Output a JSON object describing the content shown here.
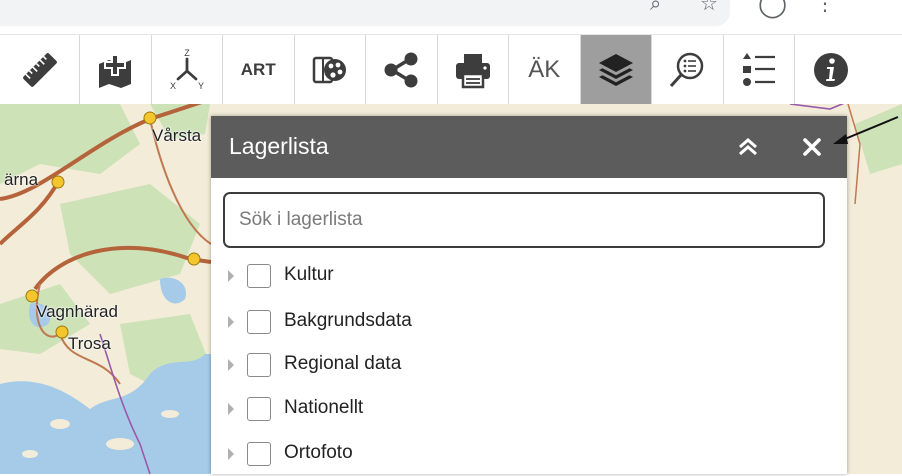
{
  "toolbar": {
    "items": [
      {
        "name": "ruler-icon"
      },
      {
        "name": "add-map-icon"
      },
      {
        "name": "xyz-coordinates-icon",
        "glyphs": [
          "Z",
          "X",
          "Y"
        ]
      },
      {
        "name": "art-tool",
        "text": "ART"
      },
      {
        "name": "palette-icon"
      },
      {
        "name": "share-icon"
      },
      {
        "name": "print-icon"
      },
      {
        "name": "ak-tool",
        "text": "ÄK"
      },
      {
        "name": "layers-icon",
        "active": true
      },
      {
        "name": "search-map-icon"
      },
      {
        "name": "legend-list-icon"
      },
      {
        "name": "info-icon"
      }
    ]
  },
  "map": {
    "labels": [
      "Vårsta",
      "ärna",
      "Vagnhärad",
      "Trosa"
    ]
  },
  "panel": {
    "title": "Lagerlista",
    "search_placeholder": "Sök i lagerlista",
    "layers": [
      "Kultur",
      "Bakgrundsdata",
      "Regional data",
      "Nationellt",
      "Ortofoto"
    ]
  },
  "colors": {
    "header": "#5c5c5c",
    "active_tool": "#9e9e9e",
    "map_water": "#a6cbe9",
    "map_land": "#f2ecd9",
    "map_forest": "#cde2b7",
    "road": "#b5633a",
    "town": "#f5c52e"
  }
}
